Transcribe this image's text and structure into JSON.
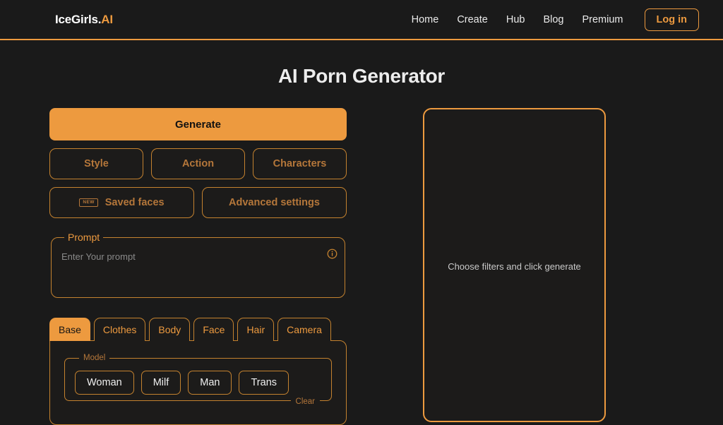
{
  "header": {
    "logo_main": "IceGirls.",
    "logo_accent": "AI",
    "nav_items": [
      {
        "label": "Home"
      },
      {
        "label": "Create"
      },
      {
        "label": "Hub"
      },
      {
        "label": "Blog"
      },
      {
        "label": "Premium"
      }
    ],
    "login_label": "Log in",
    "accent_color": "#ED9A3F"
  },
  "page": {
    "title": "AI Porn Generator",
    "background_color": "#1a1a1a"
  },
  "generator": {
    "generate_label": "Generate",
    "filter_buttons": [
      {
        "label": "Style",
        "badge": ""
      },
      {
        "label": "Action",
        "badge": ""
      },
      {
        "label": "Characters",
        "badge": ""
      }
    ],
    "secondary_buttons": [
      {
        "label": "Saved faces",
        "badge": "NEW"
      },
      {
        "label": "Advanced settings",
        "badge": ""
      }
    ],
    "prompt": {
      "legend": "Prompt",
      "placeholder": "Enter Your prompt",
      "info_icon": "info-circle-icon"
    },
    "tabs": [
      {
        "label": "Base",
        "active": true
      },
      {
        "label": "Clothes",
        "active": false
      },
      {
        "label": "Body",
        "active": false
      },
      {
        "label": "Face",
        "active": false
      },
      {
        "label": "Hair",
        "active": false
      },
      {
        "label": "Camera",
        "active": false
      }
    ],
    "model_group": {
      "legend": "Model",
      "options": [
        {
          "label": "Woman"
        },
        {
          "label": "Milf"
        },
        {
          "label": "Man"
        },
        {
          "label": "Trans"
        }
      ],
      "clear_label": "Clear"
    }
  },
  "preview": {
    "empty_text": "Choose filters and click generate"
  }
}
